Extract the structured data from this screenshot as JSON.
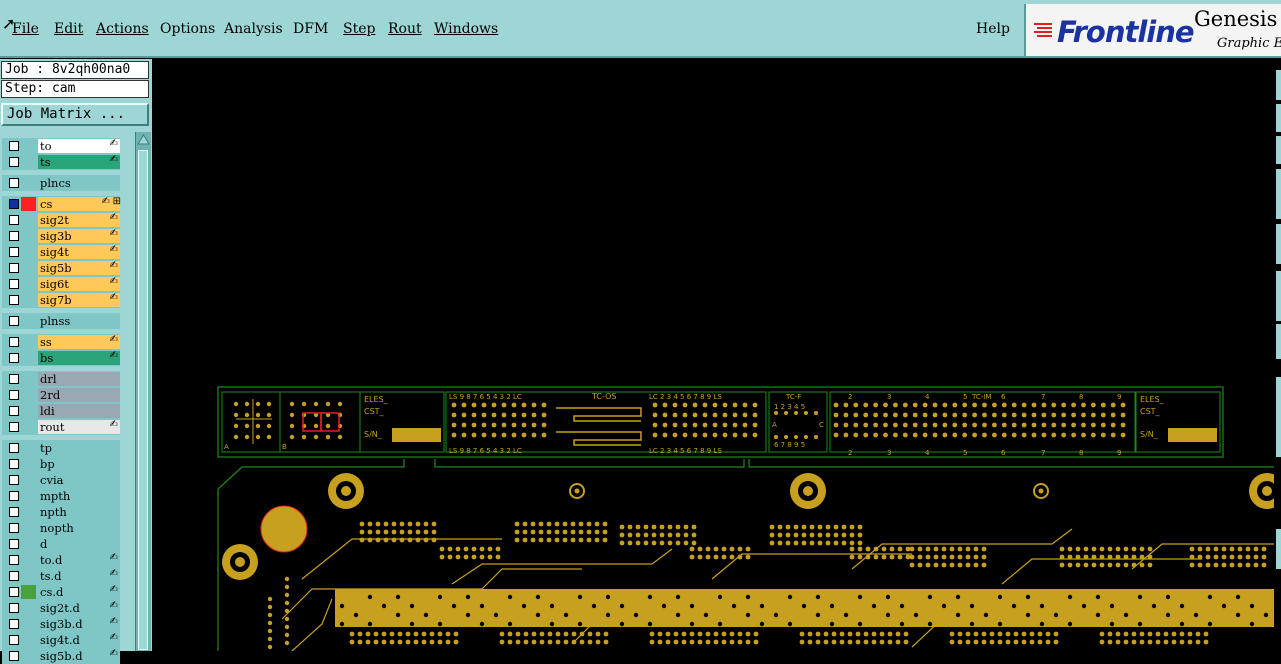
{
  "menu": {
    "items": [
      {
        "label": "File"
      },
      {
        "label": "Edit"
      },
      {
        "label": "Actions"
      },
      {
        "label": "Options"
      },
      {
        "label": "Analysis"
      },
      {
        "label": "DFM"
      },
      {
        "label": "Step"
      },
      {
        "label": "Rout"
      },
      {
        "label": "Windows"
      }
    ],
    "help": "Help"
  },
  "brand": {
    "logo": "Frontline",
    "product": "Genesis",
    "subtitle": "Graphic Ed"
  },
  "job": {
    "job_line": "Job : 8v2qh00na0",
    "step_line": "Step: cam",
    "matrix_button": "Job Matrix ..."
  },
  "colors": {
    "panel": "#9ed6d6",
    "signal": "#ffc85a",
    "mask": "#2aa57a",
    "drill": "#9aa8b4",
    "document": "#7fc7c7",
    "copper": "#c8a020",
    "outline": "#1e8a1e"
  },
  "layers": [
    {
      "name": "to",
      "kind": "white",
      "mark": "hand"
    },
    {
      "name": "ts",
      "kind": "mask",
      "mark": "hand"
    },
    {
      "name": "plncs",
      "kind": "plane"
    },
    {
      "name": "cs",
      "kind": "signal",
      "active": true,
      "color": "#ff2020",
      "mark": "hand",
      "extra": "grid"
    },
    {
      "name": "sig2t",
      "kind": "signal",
      "mark": "hand"
    },
    {
      "name": "sig3b",
      "kind": "signal",
      "mark": "hand"
    },
    {
      "name": "sig4t",
      "kind": "signal",
      "mark": "hand"
    },
    {
      "name": "sig5b",
      "kind": "signal",
      "mark": "hand"
    },
    {
      "name": "sig6t",
      "kind": "signal",
      "mark": "hand"
    },
    {
      "name": "sig7b",
      "kind": "signal",
      "mark": "hand"
    },
    {
      "name": "plnss",
      "kind": "plane"
    },
    {
      "name": "ss",
      "kind": "signal",
      "mark": "hand"
    },
    {
      "name": "bs",
      "kind": "mask",
      "mark": "hand"
    },
    {
      "name": "drl",
      "kind": "drill"
    },
    {
      "name": "2rd",
      "kind": "drill"
    },
    {
      "name": "ldi",
      "kind": "drill"
    },
    {
      "name": "rout",
      "kind": "rout",
      "mark": "hand"
    },
    {
      "name": "tp",
      "kind": "doc"
    },
    {
      "name": "bp",
      "kind": "doc"
    },
    {
      "name": "cvia",
      "kind": "doc"
    },
    {
      "name": "mpth",
      "kind": "doc"
    },
    {
      "name": "npth",
      "kind": "doc"
    },
    {
      "name": "nopth",
      "kind": "doc"
    },
    {
      "name": "d",
      "kind": "doc"
    },
    {
      "name": "to.d",
      "kind": "doc",
      "mark": "hand"
    },
    {
      "name": "ts.d",
      "kind": "doc",
      "mark": "hand"
    },
    {
      "name": "cs.d",
      "kind": "doc",
      "color": "#4aa03a",
      "mark": "hand"
    },
    {
      "name": "sig2t.d",
      "kind": "doc",
      "mark": "hand"
    },
    {
      "name": "sig3b.d",
      "kind": "doc",
      "mark": "hand"
    },
    {
      "name": "sig4t.d",
      "kind": "doc",
      "mark": "hand"
    },
    {
      "name": "sig5b.d",
      "kind": "doc",
      "mark": "hand"
    }
  ],
  "board": {
    "labels": {
      "eles": "ELES_",
      "cst": "CST_",
      "sn": "S/N_",
      "tc_os": "TC-OS",
      "tc_f": "TC-F",
      "tc_im": "TC-IM",
      "ls_left": "LS 9 8 7 6 5 4 3 2 LC",
      "lc_right": "LC 2 3 4 5 6 7 8 9 LS",
      "letter_a": "A",
      "letter_b": "B",
      "letter_c": "C",
      "tcf_top": "1 2 3 4 5",
      "tcf_bottom": "6 7 8 9 5",
      "im_numbers": [
        "2",
        "3",
        "4",
        "5",
        "6",
        "7",
        "8",
        "9"
      ]
    }
  }
}
